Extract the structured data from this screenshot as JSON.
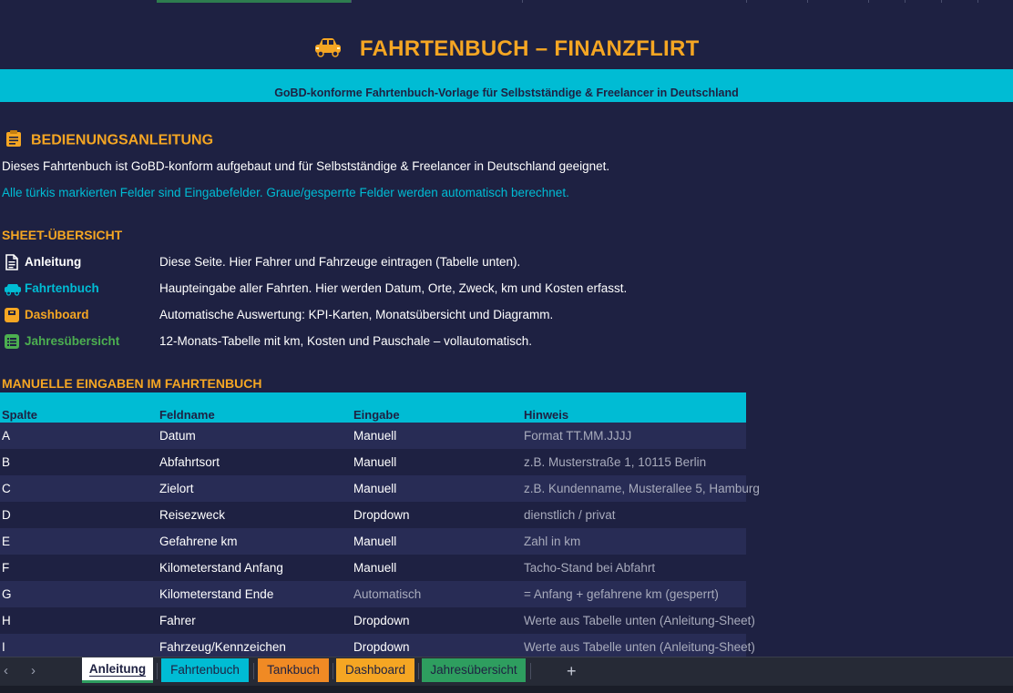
{
  "header": {
    "title": "FAHRTENBUCH – FINANZFLIRT",
    "subtitle": "GoBD-konforme Fahrtenbuch-Vorlage für Selbstständige & Freelancer in Deutschland"
  },
  "instructions": {
    "heading": "BEDIENUNGSANLEITUNG",
    "line1": "Dieses Fahrtenbuch ist GoBD-konform aufgebaut und für Selbstständige & Freelancer in Deutschland geeignet.",
    "line2": "Alle türkis markierten Felder sind Eingabefelder. Graue/gesperrte Felder werden automatisch berechnet."
  },
  "overview": {
    "heading": "SHEET-ÜBERSICHT",
    "items": [
      {
        "name": "Anleitung",
        "desc": "Diese Seite. Hier Fahrer und Fahrzeuge eintragen (Tabelle unten).",
        "icon": "document-icon",
        "color": "#ffffff"
      },
      {
        "name": "Fahrtenbuch",
        "desc": "Haupteingabe aller Fahrten. Hier werden Datum, Orte, Zweck, km und Kosten erfasst.",
        "icon": "car-icon",
        "color": "#00bcd4"
      },
      {
        "name": "Dashboard",
        "desc": "Automatische Auswertung: KPI-Karten, Monatsübersicht und Diagramm.",
        "icon": "dashboard-icon",
        "color": "#f5a623"
      },
      {
        "name": "Jahresübersicht",
        "desc": "12-Monats-Tabelle mit km, Kosten und Pauschale – vollautomatisch.",
        "icon": "table-icon",
        "color": "#4caf50"
      }
    ]
  },
  "manual": {
    "heading": "MANUELLE EINGABEN IM FAHRTENBUCH",
    "columns": [
      "Spalte",
      "Feldname",
      "Eingabe",
      "Hinweis"
    ],
    "rows": [
      [
        "A",
        "Datum",
        "Manuell",
        "Format TT.MM.JJJJ"
      ],
      [
        "B",
        "Abfahrtsort",
        "Manuell",
        "z.B. Musterstraße 1, 10115 Berlin"
      ],
      [
        "C",
        "Zielort",
        "Manuell",
        "z.B. Kundenname, Musterallee 5, Hamburg"
      ],
      [
        "D",
        "Reisezweck",
        "Dropdown",
        "dienstlich / privat"
      ],
      [
        "E",
        "Gefahrene km",
        "Manuell",
        "Zahl in km"
      ],
      [
        "F",
        "Kilometerstand Anfang",
        "Manuell",
        "Tacho-Stand bei Abfahrt"
      ],
      [
        "G",
        "Kilometerstand Ende",
        "Automatisch",
        "= Anfang + gefahrene km (gesperrt)"
      ],
      [
        "H",
        "Fahrer",
        "Dropdown",
        "Werte aus Tabelle unten (Anleitung-Sheet)"
      ],
      [
        "I",
        "Fahrzeug/Kennzeichen",
        "Dropdown",
        "Werte aus Tabelle unten (Anleitung-Sheet)"
      ]
    ]
  },
  "tabs": [
    {
      "label": "Anleitung",
      "bg": "#ffffff"
    },
    {
      "label": "Fahrtenbuch",
      "bg": "#00bcd4"
    },
    {
      "label": "Tankbuch",
      "bg": "#f08a24"
    },
    {
      "label": "Dashboard",
      "bg": "#f5a623"
    },
    {
      "label": "Jahresübersicht",
      "bg": "#2e9e5f"
    }
  ],
  "colors": {
    "background": "#1e2142",
    "accent_orange": "#f5a623",
    "accent_teal": "#00bcd4",
    "row_alt": "#282c55"
  }
}
